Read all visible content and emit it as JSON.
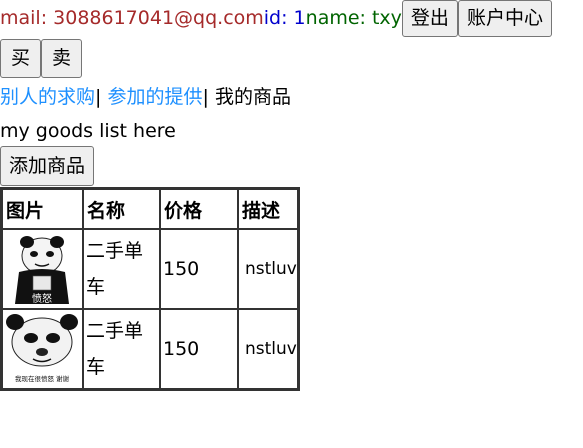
{
  "header": {
    "mail_text": "mail: 3088617041@qq.com",
    "id_text": " id: 1",
    "name_text": " name: txy",
    "login_button": "登出",
    "account_button": "账户中心"
  },
  "mode_buttons": {
    "buy": "买",
    "sell": "卖"
  },
  "tabs": {
    "others_requests": "别人的求购",
    "sep1": "| ",
    "joined_offers": "参加的提供",
    "sep2": "| ",
    "my_goods": "我的商品"
  },
  "message": "my goods list here",
  "add_goods_button": "添加商品",
  "table": {
    "headers": [
      "图片",
      "名称",
      "价格",
      "描述"
    ],
    "rows": [
      {
        "image": "panda-meme-1",
        "image_caption": "愤怒",
        "name": "二手单车",
        "price": "150",
        "description": "nstluv"
      },
      {
        "image": "panda-meme-2",
        "image_caption": "我现在很愤怒 谢谢",
        "name": "二手单车",
        "price": "150",
        "description": "nstluv"
      }
    ]
  }
}
